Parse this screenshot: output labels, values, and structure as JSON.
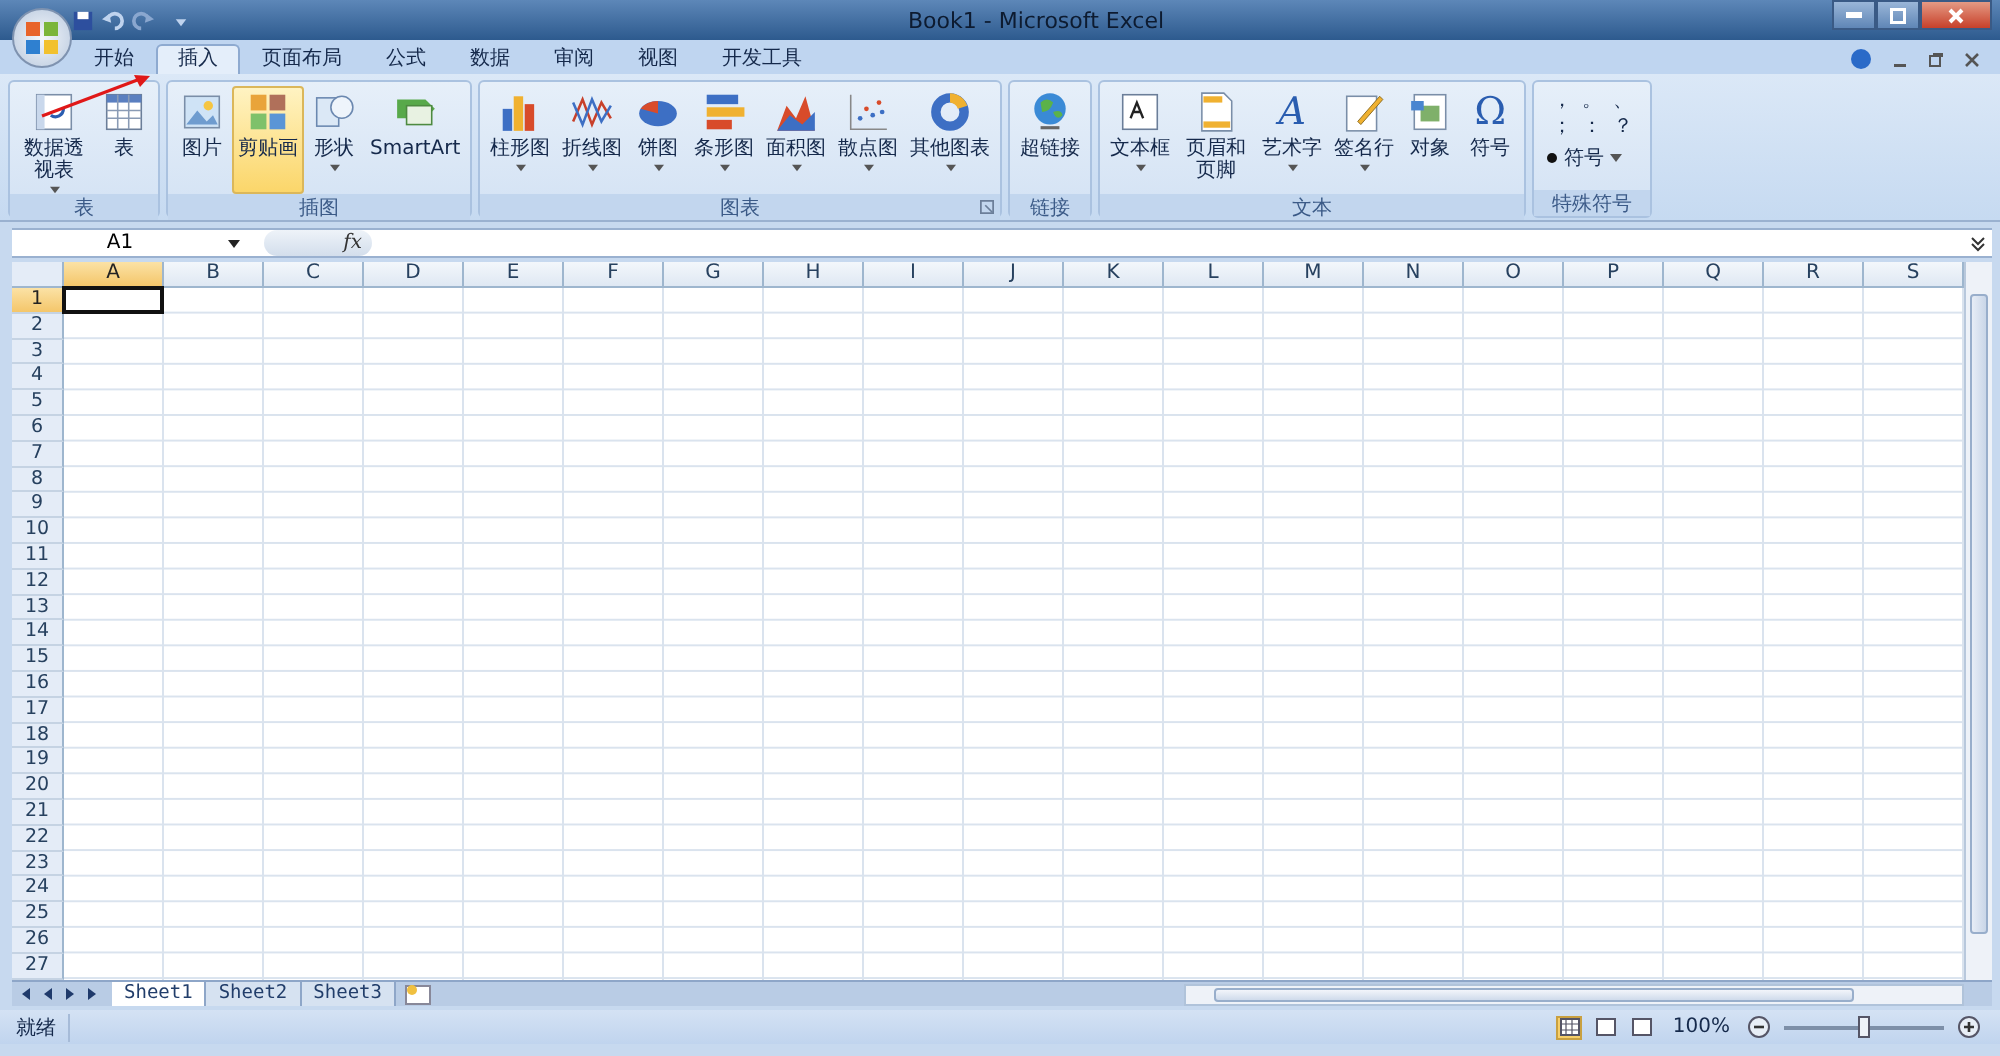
{
  "window": {
    "title": "Book1 - Microsoft Excel"
  },
  "tabs": [
    {
      "label": "开始",
      "selected": false
    },
    {
      "label": "插入",
      "selected": true
    },
    {
      "label": "页面布局",
      "selected": false
    },
    {
      "label": "公式",
      "selected": false
    },
    {
      "label": "数据",
      "selected": false
    },
    {
      "label": "审阅",
      "selected": false
    },
    {
      "label": "视图",
      "selected": false
    },
    {
      "label": "开发工具",
      "selected": false
    }
  ],
  "ribbon_groups": [
    {
      "name": "表",
      "launcher": false,
      "buttons": [
        {
          "label": "数据透视表",
          "wrap": true,
          "dropdown": true,
          "highlighted": false
        },
        {
          "label": "表",
          "dropdown": false,
          "highlighted": false
        }
      ]
    },
    {
      "name": "插图",
      "launcher": false,
      "buttons": [
        {
          "label": "图片",
          "dropdown": false,
          "highlighted": false
        },
        {
          "label": "剪贴画",
          "dropdown": false,
          "highlighted": true
        },
        {
          "label": "形状",
          "dropdown": true,
          "highlighted": false
        },
        {
          "label": "SmartArt",
          "dropdown": false,
          "highlighted": false
        }
      ]
    },
    {
      "name": "图表",
      "launcher": true,
      "buttons": [
        {
          "label": "柱形图",
          "dropdown": true,
          "highlighted": false
        },
        {
          "label": "折线图",
          "dropdown": true,
          "highlighted": false
        },
        {
          "label": "饼图",
          "dropdown": true,
          "highlighted": false
        },
        {
          "label": "条形图",
          "dropdown": true,
          "highlighted": false
        },
        {
          "label": "面积图",
          "dropdown": true,
          "highlighted": false
        },
        {
          "label": "散点图",
          "dropdown": true,
          "highlighted": false
        },
        {
          "label": "其他图表",
          "dropdown": true,
          "highlighted": false
        }
      ]
    },
    {
      "name": "链接",
      "launcher": false,
      "buttons": [
        {
          "label": "超链接",
          "dropdown": false,
          "highlighted": false
        }
      ]
    },
    {
      "name": "文本",
      "launcher": false,
      "buttons": [
        {
          "label": "文本框",
          "dropdown": true,
          "highlighted": false
        },
        {
          "label": "页眉和页脚",
          "wrap": true,
          "dropdown": false,
          "highlighted": false
        },
        {
          "label": "艺术字",
          "dropdown": true,
          "highlighted": false,
          "glyph": "A"
        },
        {
          "label": "签名行",
          "dropdown": true,
          "highlighted": false
        },
        {
          "label": "对象",
          "dropdown": false,
          "highlighted": false
        },
        {
          "label": "符号",
          "dropdown": false,
          "highlighted": false,
          "glyph": "Ω"
        }
      ]
    }
  ],
  "special_symbols": {
    "name": "特殊符号",
    "symbols": [
      "，",
      "。",
      "、",
      "；",
      "：",
      "？"
    ],
    "button": "符号"
  },
  "formula_bar": {
    "name_box": "A1",
    "fx": "fx"
  },
  "columns": [
    {
      "label": "A",
      "selected": true
    },
    {
      "label": "B",
      "selected": false
    },
    {
      "label": "C",
      "selected": false
    },
    {
      "label": "D",
      "selected": false
    },
    {
      "label": "E",
      "selected": false
    },
    {
      "label": "F",
      "selected": false
    },
    {
      "label": "G",
      "selected": false
    },
    {
      "label": "H",
      "selected": false
    },
    {
      "label": "I",
      "selected": false
    },
    {
      "label": "J",
      "selected": false
    },
    {
      "label": "K",
      "selected": false
    },
    {
      "label": "L",
      "selected": false
    },
    {
      "label": "M",
      "selected": false
    },
    {
      "label": "N",
      "selected": false
    },
    {
      "label": "O",
      "selected": false
    },
    {
      "label": "P",
      "selected": false
    },
    {
      "label": "Q",
      "selected": false
    },
    {
      "label": "R",
      "selected": false
    },
    {
      "label": "S",
      "selected": false
    }
  ],
  "rows": [
    {
      "label": "1",
      "selected": true
    },
    {
      "label": "2",
      "selected": false
    },
    {
      "label": "3",
      "selected": false
    },
    {
      "label": "4",
      "selected": false
    },
    {
      "label": "5",
      "selected": false
    },
    {
      "label": "6",
      "selected": false
    },
    {
      "label": "7",
      "selected": false
    },
    {
      "label": "8",
      "selected": false
    },
    {
      "label": "9",
      "selected": false
    },
    {
      "label": "10",
      "selected": false
    },
    {
      "label": "11",
      "selected": false
    },
    {
      "label": "12",
      "selected": false
    },
    {
      "label": "13",
      "selected": false
    },
    {
      "label": "14",
      "selected": false
    },
    {
      "label": "15",
      "selected": false
    },
    {
      "label": "16",
      "selected": false
    },
    {
      "label": "17",
      "selected": false
    },
    {
      "label": "18",
      "selected": false
    },
    {
      "label": "19",
      "selected": false
    },
    {
      "label": "20",
      "selected": false
    },
    {
      "label": "21",
      "selected": false
    },
    {
      "label": "22",
      "selected": false
    },
    {
      "label": "23",
      "selected": false
    },
    {
      "label": "24",
      "selected": false
    },
    {
      "label": "25",
      "selected": false
    },
    {
      "label": "26",
      "selected": false
    },
    {
      "label": "27",
      "selected": false
    }
  ],
  "sheet_tabs": [
    {
      "label": "Sheet1",
      "selected": true
    },
    {
      "label": "Sheet2",
      "selected": false
    },
    {
      "label": "Sheet3",
      "selected": false
    }
  ],
  "status_bar": {
    "status": "就绪",
    "views": [
      {
        "selected": true
      },
      {
        "selected": false
      },
      {
        "selected": false
      }
    ],
    "zoom": "100%",
    "zoom_level": {
      "level": 0.5
    }
  }
}
